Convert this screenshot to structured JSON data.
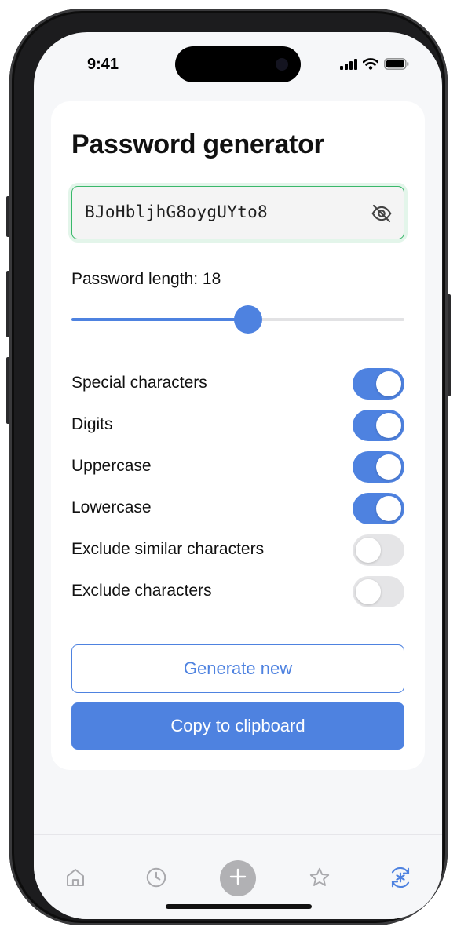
{
  "status_bar": {
    "time": "9:41",
    "icons": [
      "cellular-signal-icon",
      "wifi-icon",
      "battery-icon"
    ]
  },
  "screen": {
    "title": "Password generator",
    "password": {
      "value": "BJoHbljhG8oygUYto8",
      "visibility_icon": "eye-off-icon",
      "border_color": "#39b86a"
    },
    "length": {
      "label": "Password length: 18",
      "value": 18,
      "slider_fraction": 0.53
    },
    "options": [
      {
        "label": "Special characters",
        "enabled": true
      },
      {
        "label": "Digits",
        "enabled": true
      },
      {
        "label": "Uppercase",
        "enabled": true
      },
      {
        "label": "Lowercase",
        "enabled": true
      },
      {
        "label": "Exclude similar characters",
        "enabled": false
      },
      {
        "label": "Exclude characters",
        "enabled": false
      }
    ],
    "buttons": {
      "generate_label": "Generate new",
      "copy_label": "Copy to clipboard"
    }
  },
  "tab_bar": {
    "items": [
      {
        "icon": "home-icon",
        "active": false
      },
      {
        "icon": "clock-icon",
        "active": false
      },
      {
        "icon": "plus-icon",
        "active": false
      },
      {
        "icon": "star-icon",
        "active": false
      },
      {
        "icon": "password-generator-icon",
        "active": true
      }
    ]
  },
  "colors": {
    "accent": "#4e82e0",
    "success": "#39b86a",
    "toggle_off": "#e5e5e7",
    "inactive_icon": "#a9a9ad"
  }
}
